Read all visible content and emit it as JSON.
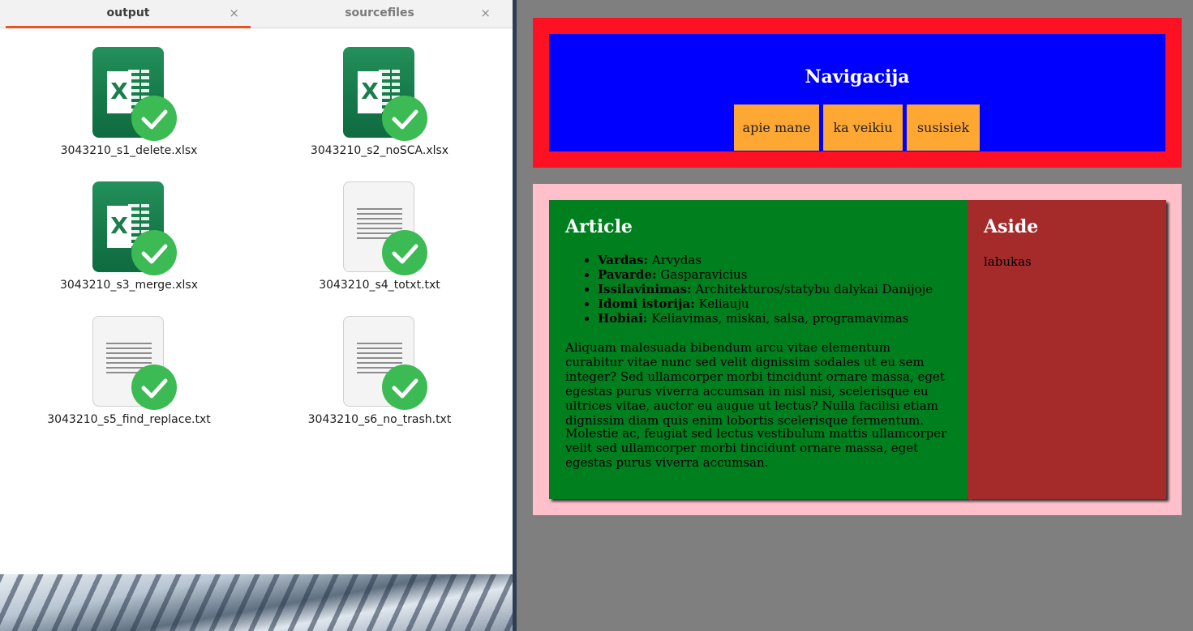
{
  "file_manager": {
    "tabs": [
      {
        "label": "output",
        "close": "×"
      },
      {
        "label": "sourcefiles",
        "close": "×"
      }
    ],
    "files": [
      {
        "name": "3043210_s1_delete.xlsx",
        "icon": "spreadsheet-icon"
      },
      {
        "name": "3043210_s2_noSCA.xlsx",
        "icon": "spreadsheet-icon"
      },
      {
        "name": "3043210_s3_merge.xlsx",
        "icon": "spreadsheet-icon"
      },
      {
        "name": "3043210_s4_totxt.txt",
        "icon": "text-file-icon"
      },
      {
        "name": "3043210_s5_find_replace.txt",
        "icon": "text-file-icon"
      },
      {
        "name": "3043210_s6_no_trash.txt",
        "icon": "text-file-icon"
      }
    ],
    "accent": "#e95420",
    "check_color": "#3cba54"
  },
  "webpage": {
    "nav": {
      "title": "Navigacija",
      "links": [
        "apie mane",
        "ka veikiu",
        "susisiek"
      ]
    },
    "article": {
      "title": "Article",
      "facts": [
        {
          "key": "Vardas:",
          "value": "Arvydas"
        },
        {
          "key": "Pavarde:",
          "value": "Gasparavicius"
        },
        {
          "key": "Issilavinimas:",
          "value": "Architekturos/statybu dalykai Danijoje"
        },
        {
          "key": "Idomi istorija:",
          "value": "Keliauju"
        },
        {
          "key": "Hobiai:",
          "value": "Keliavimas, miskai, salsa, programavimas"
        }
      ],
      "paragraphs": [
        "Aliquam malesuada bibendum arcu vitae elementum curabitur vitae nunc sed velit dignissim sodales ut eu sem integer? Sed ullamcorper morbi tincidunt ornare massa, eget egestas purus viverra accumsan in nisl nisi, scelerisque eu ultrices vitae, auctor eu augue ut lectus? Nulla facilisi etiam dignissim diam quis enim lobortis scelerisque fermentum.",
        "Molestie ac, feugiat sed lectus vestibulum mattis ullamcorper velit sed ullamcorper morbi tincidunt ornare massa, eget egestas purus viverra accumsan."
      ]
    },
    "aside": {
      "title": "Aside",
      "text": "labukas"
    },
    "colors": {
      "page_bg": "#7f7f7f",
      "header": "#ff1124",
      "nav": "#0000ff",
      "nav_button": "#ffa733",
      "main": "#ffc0cb",
      "article": "#007f1f",
      "aside": "#a52a2a"
    }
  }
}
